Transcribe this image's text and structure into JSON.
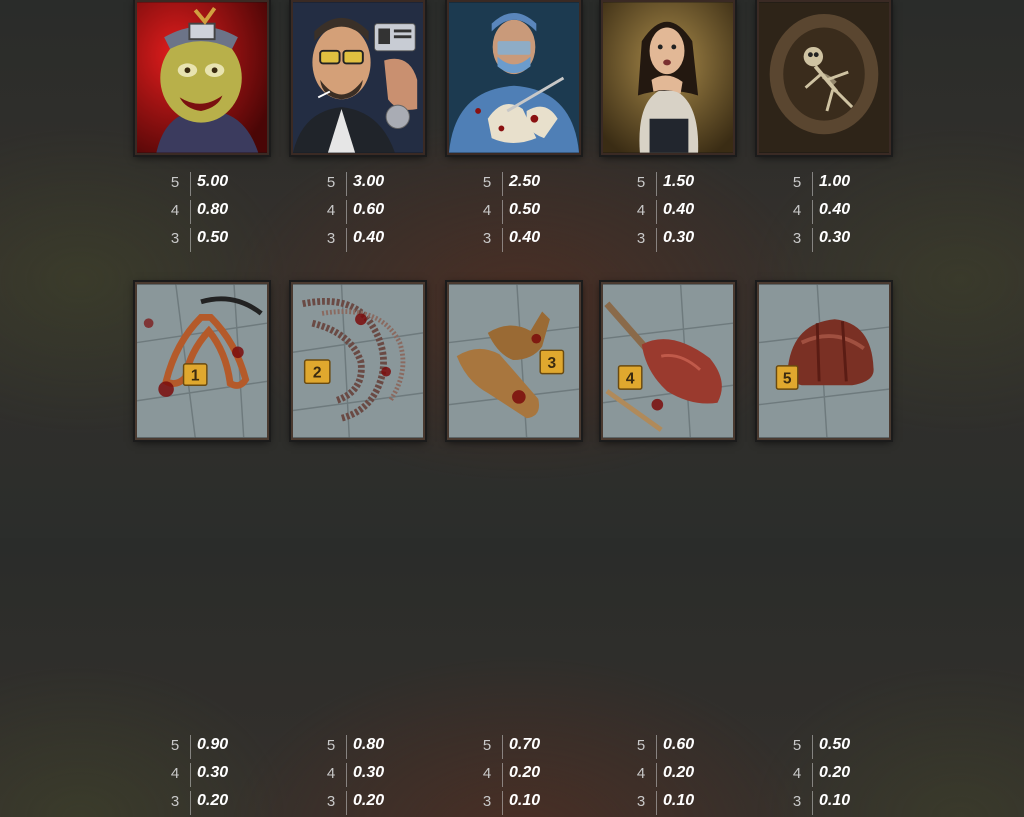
{
  "high_symbols": [
    {
      "icon": "zombie-clown-portrait",
      "pays": [
        {
          "count": "5",
          "value": "5.00"
        },
        {
          "count": "4",
          "value": "0.80"
        },
        {
          "count": "3",
          "value": "0.50"
        }
      ]
    },
    {
      "icon": "special-agent-portrait",
      "pays": [
        {
          "count": "5",
          "value": "3.00"
        },
        {
          "count": "4",
          "value": "0.60"
        },
        {
          "count": "3",
          "value": "0.40"
        }
      ]
    },
    {
      "icon": "surgeon-portrait",
      "pays": [
        {
          "count": "5",
          "value": "2.50"
        },
        {
          "count": "4",
          "value": "0.50"
        },
        {
          "count": "3",
          "value": "0.40"
        }
      ]
    },
    {
      "icon": "frightened-woman-portrait",
      "pays": [
        {
          "count": "5",
          "value": "1.50"
        },
        {
          "count": "4",
          "value": "0.40"
        },
        {
          "count": "3",
          "value": "0.30"
        }
      ]
    },
    {
      "icon": "skeleton-in-pit",
      "pays": [
        {
          "count": "5",
          "value": "1.00"
        },
        {
          "count": "4",
          "value": "0.40"
        },
        {
          "count": "3",
          "value": "0.30"
        }
      ]
    }
  ],
  "low_symbols": [
    {
      "icon": "bloody-tongs",
      "marker": "1",
      "pays": [
        {
          "count": "5",
          "value": "0.90"
        },
        {
          "count": "4",
          "value": "0.30"
        },
        {
          "count": "3",
          "value": "0.20"
        }
      ]
    },
    {
      "icon": "bloody-chainsaw-chain",
      "marker": "2",
      "pays": [
        {
          "count": "5",
          "value": "0.80"
        },
        {
          "count": "4",
          "value": "0.30"
        },
        {
          "count": "3",
          "value": "0.20"
        }
      ]
    },
    {
      "icon": "bloody-gloves",
      "marker": "3",
      "pays": [
        {
          "count": "5",
          "value": "0.70"
        },
        {
          "count": "4",
          "value": "0.20"
        },
        {
          "count": "3",
          "value": "0.10"
        }
      ]
    },
    {
      "icon": "bloody-shovel",
      "marker": "4",
      "pays": [
        {
          "count": "5",
          "value": "0.60"
        },
        {
          "count": "4",
          "value": "0.20"
        },
        {
          "count": "3",
          "value": "0.10"
        }
      ]
    },
    {
      "icon": "bloody-hard-hat",
      "marker": "5",
      "pays": [
        {
          "count": "5",
          "value": "0.50"
        },
        {
          "count": "4",
          "value": "0.20"
        },
        {
          "count": "3",
          "value": "0.10"
        }
      ]
    }
  ],
  "colors": {
    "marker": "#e0a82e",
    "blood": "#7a0c0c",
    "tile": "#8a979a"
  }
}
